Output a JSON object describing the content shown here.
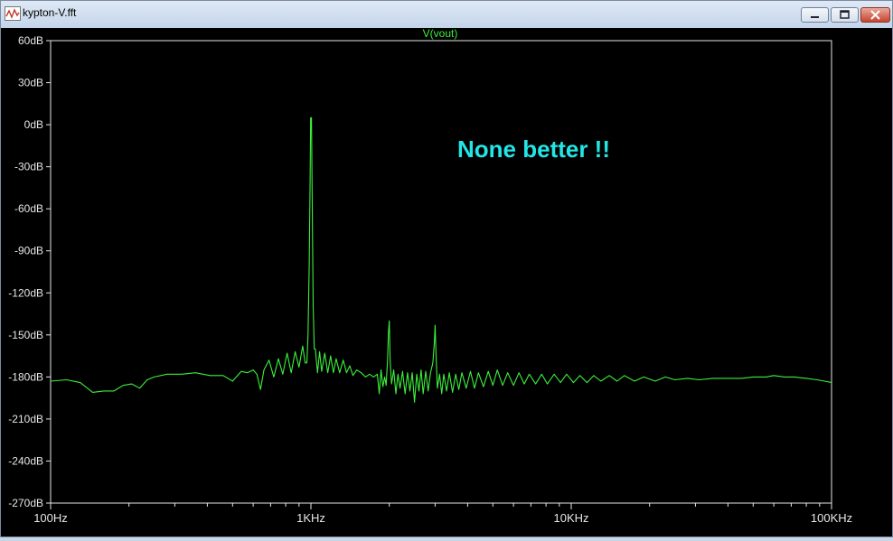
{
  "window": {
    "title": "kypton-V.fft"
  },
  "icons": {
    "app": "waveform-icon",
    "minimize": "minimize-icon",
    "maximize": "maximize-icon",
    "close": "close-icon"
  },
  "colors": {
    "trace": "#3cf03c",
    "axis": "#e6e6e6",
    "label": "#e6e6e6",
    "annotation": "#22e6e6",
    "background": "#000000"
  },
  "annotation": {
    "text": "None better !!"
  },
  "chart_data": {
    "type": "line",
    "title": "V(vout)",
    "xscale": "log",
    "xlabel": "",
    "ylabel": "",
    "xlim": [
      100,
      100000
    ],
    "ylim": [
      -270,
      60
    ],
    "x_ticks": [
      {
        "value": 100,
        "label": "100Hz"
      },
      {
        "value": 1000,
        "label": "1KHz"
      },
      {
        "value": 10000,
        "label": "10KHz"
      },
      {
        "value": 100000,
        "label": "100KHz"
      }
    ],
    "y_ticks": [
      {
        "value": 60,
        "label": "60dB"
      },
      {
        "value": 30,
        "label": "30dB"
      },
      {
        "value": 0,
        "label": "0dB"
      },
      {
        "value": -30,
        "label": "-30dB"
      },
      {
        "value": -60,
        "label": "-60dB"
      },
      {
        "value": -90,
        "label": "-90dB"
      },
      {
        "value": -120,
        "label": "-120dB"
      },
      {
        "value": -150,
        "label": "-150dB"
      },
      {
        "value": -180,
        "label": "-180dB"
      },
      {
        "value": -210,
        "label": "-210dB"
      },
      {
        "value": -240,
        "label": "-240dB"
      },
      {
        "value": -270,
        "label": "-270dB"
      }
    ],
    "grid": false,
    "series": [
      {
        "name": "V(vout)",
        "points": [
          [
            100,
            -183
          ],
          [
            115,
            -182
          ],
          [
            130,
            -184
          ],
          [
            145,
            -191
          ],
          [
            160,
            -190
          ],
          [
            175,
            -190
          ],
          [
            190,
            -186
          ],
          [
            205,
            -185
          ],
          [
            220,
            -188
          ],
          [
            235,
            -182
          ],
          [
            250,
            -180
          ],
          [
            280,
            -178
          ],
          [
            320,
            -178
          ],
          [
            360,
            -177
          ],
          [
            410,
            -179
          ],
          [
            460,
            -179
          ],
          [
            500,
            -183
          ],
          [
            540,
            -176
          ],
          [
            570,
            -177
          ],
          [
            600,
            -175
          ],
          [
            620,
            -178
          ],
          [
            640,
            -189
          ],
          [
            660,
            -175
          ],
          [
            690,
            -168
          ],
          [
            720,
            -180
          ],
          [
            750,
            -167
          ],
          [
            780,
            -178
          ],
          [
            810,
            -163
          ],
          [
            840,
            -177
          ],
          [
            870,
            -162
          ],
          [
            900,
            -173
          ],
          [
            930,
            -158
          ],
          [
            950,
            -170
          ],
          [
            965,
            -170
          ],
          [
            975,
            -150
          ],
          [
            985,
            -100
          ],
          [
            993,
            -40
          ],
          [
            998,
            5
          ],
          [
            1000,
            -2
          ],
          [
            1005,
            5
          ],
          [
            1012,
            -60
          ],
          [
            1020,
            -130
          ],
          [
            1030,
            -160
          ],
          [
            1040,
            -160
          ],
          [
            1060,
            -177
          ],
          [
            1080,
            -162
          ],
          [
            1100,
            -176
          ],
          [
            1130,
            -163
          ],
          [
            1160,
            -177
          ],
          [
            1190,
            -165
          ],
          [
            1220,
            -177
          ],
          [
            1250,
            -167
          ],
          [
            1290,
            -177
          ],
          [
            1330,
            -168
          ],
          [
            1370,
            -177
          ],
          [
            1410,
            -172
          ],
          [
            1450,
            -179
          ],
          [
            1500,
            -175
          ],
          [
            1560,
            -177
          ],
          [
            1620,
            -180
          ],
          [
            1680,
            -178
          ],
          [
            1740,
            -180
          ],
          [
            1800,
            -178
          ],
          [
            1830,
            -192
          ],
          [
            1860,
            -175
          ],
          [
            1890,
            -187
          ],
          [
            1920,
            -180
          ],
          [
            1945,
            -186
          ],
          [
            1970,
            -168
          ],
          [
            1985,
            -148
          ],
          [
            2000,
            -140
          ],
          [
            2015,
            -168
          ],
          [
            2040,
            -185
          ],
          [
            2080,
            -175
          ],
          [
            2120,
            -192
          ],
          [
            2160,
            -178
          ],
          [
            2200,
            -188
          ],
          [
            2250,
            -176
          ],
          [
            2300,
            -192
          ],
          [
            2350,
            -177
          ],
          [
            2400,
            -190
          ],
          [
            2450,
            -177
          ],
          [
            2500,
            -198
          ],
          [
            2550,
            -178
          ],
          [
            2600,
            -190
          ],
          [
            2650,
            -175
          ],
          [
            2700,
            -192
          ],
          [
            2760,
            -176
          ],
          [
            2820,
            -190
          ],
          [
            2880,
            -177
          ],
          [
            2940,
            -170
          ],
          [
            2980,
            -155
          ],
          [
            3000,
            -143
          ],
          [
            3020,
            -160
          ],
          [
            3060,
            -188
          ],
          [
            3120,
            -178
          ],
          [
            3180,
            -192
          ],
          [
            3240,
            -178
          ],
          [
            3320,
            -190
          ],
          [
            3400,
            -177
          ],
          [
            3500,
            -191
          ],
          [
            3600,
            -178
          ],
          [
            3700,
            -189
          ],
          [
            3800,
            -177
          ],
          [
            3950,
            -188
          ],
          [
            4100,
            -176
          ],
          [
            4250,
            -188
          ],
          [
            4400,
            -177
          ],
          [
            4600,
            -187
          ],
          [
            4800,
            -176
          ],
          [
            5000,
            -186
          ],
          [
            5200,
            -175
          ],
          [
            5450,
            -186
          ],
          [
            5700,
            -177
          ],
          [
            6000,
            -186
          ],
          [
            6300,
            -177
          ],
          [
            6600,
            -185
          ],
          [
            6900,
            -178
          ],
          [
            7300,
            -185
          ],
          [
            7700,
            -178
          ],
          [
            8100,
            -185
          ],
          [
            8600,
            -178
          ],
          [
            9100,
            -184
          ],
          [
            9600,
            -178
          ],
          [
            10200,
            -184
          ],
          [
            10800,
            -179
          ],
          [
            11500,
            -184
          ],
          [
            12200,
            -179
          ],
          [
            13000,
            -183
          ],
          [
            14000,
            -179
          ],
          [
            15000,
            -183
          ],
          [
            16000,
            -179
          ],
          [
            17500,
            -183
          ],
          [
            19000,
            -180
          ],
          [
            21000,
            -183
          ],
          [
            23000,
            -180
          ],
          [
            25000,
            -182
          ],
          [
            28000,
            -181
          ],
          [
            31000,
            -182
          ],
          [
            35000,
            -181
          ],
          [
            40000,
            -181
          ],
          [
            45000,
            -181
          ],
          [
            50000,
            -180
          ],
          [
            56000,
            -180
          ],
          [
            60000,
            -179
          ],
          [
            66000,
            -180
          ],
          [
            72000,
            -180
          ],
          [
            80000,
            -181
          ],
          [
            88000,
            -182
          ],
          [
            94000,
            -183
          ],
          [
            100000,
            -184
          ]
        ]
      }
    ]
  }
}
